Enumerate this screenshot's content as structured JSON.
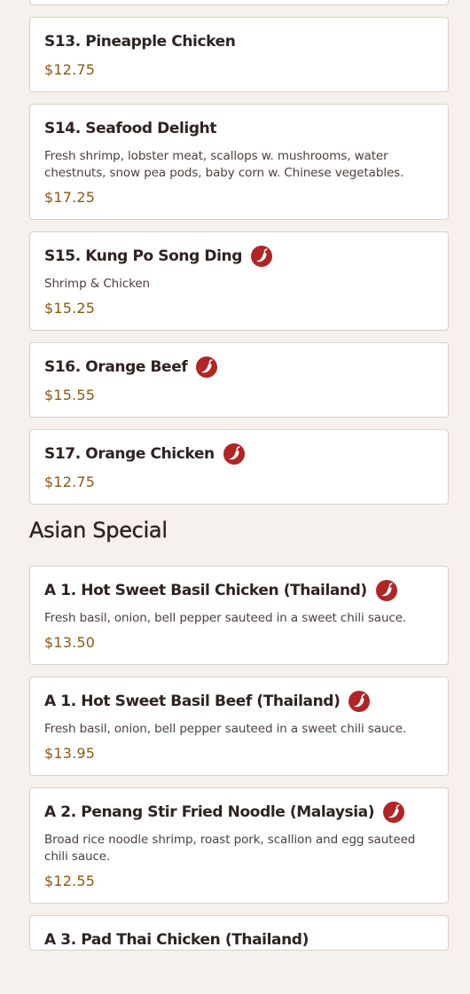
{
  "colors": {
    "page_background": "#f6f1ec",
    "card_background": "#ffffff",
    "card_border": "#d9d1c9",
    "title_text": "#2e2322",
    "price_text": "#8a5a12",
    "spicy_badge": "#b22525"
  },
  "icons": {
    "spicy": "chili-pepper-icon"
  },
  "menu_before": [
    {
      "name": "S13. Pineapple Chicken",
      "spicy": false,
      "description": "",
      "price": "$12.75"
    },
    {
      "name": "S14. Seafood Delight",
      "spicy": false,
      "description": "Fresh shrimp, lobster meat, scallops w. mushrooms, water chestnuts, snow pea pods, baby corn w. Chinese vegetables.",
      "price": "$17.25"
    },
    {
      "name": "S15. Kung Po Song Ding",
      "spicy": true,
      "description": "Shrimp & Chicken",
      "price": "$15.25"
    },
    {
      "name": "S16. Orange Beef",
      "spicy": true,
      "description": "",
      "price": "$15.55"
    },
    {
      "name": "S17. Orange Chicken",
      "spicy": true,
      "description": "",
      "price": "$12.75"
    }
  ],
  "asian_special": {
    "heading": "Asian Special",
    "items": [
      {
        "name": "A 1. Hot Sweet Basil Chicken (Thailand)",
        "spicy": true,
        "description": "Fresh basil, onion, bell pepper sauteed in a sweet chili sauce.",
        "price": "$13.50"
      },
      {
        "name": "A 1. Hot Sweet Basil Beef (Thailand)",
        "spicy": true,
        "description": "Fresh basil, onion, bell pepper sauteed in a sweet chili sauce.",
        "price": "$13.95"
      },
      {
        "name": "A 2. Penang Stir Fried Noodle (Malaysia)",
        "spicy": true,
        "description": "Broad rice noodle shrimp, roast pork, scallion and egg sauteed chili sauce.",
        "price": "$12.55"
      },
      {
        "name": "A 3. Pad Thai Chicken (Thailand)",
        "spicy": false,
        "description": "",
        "price": ""
      }
    ]
  }
}
